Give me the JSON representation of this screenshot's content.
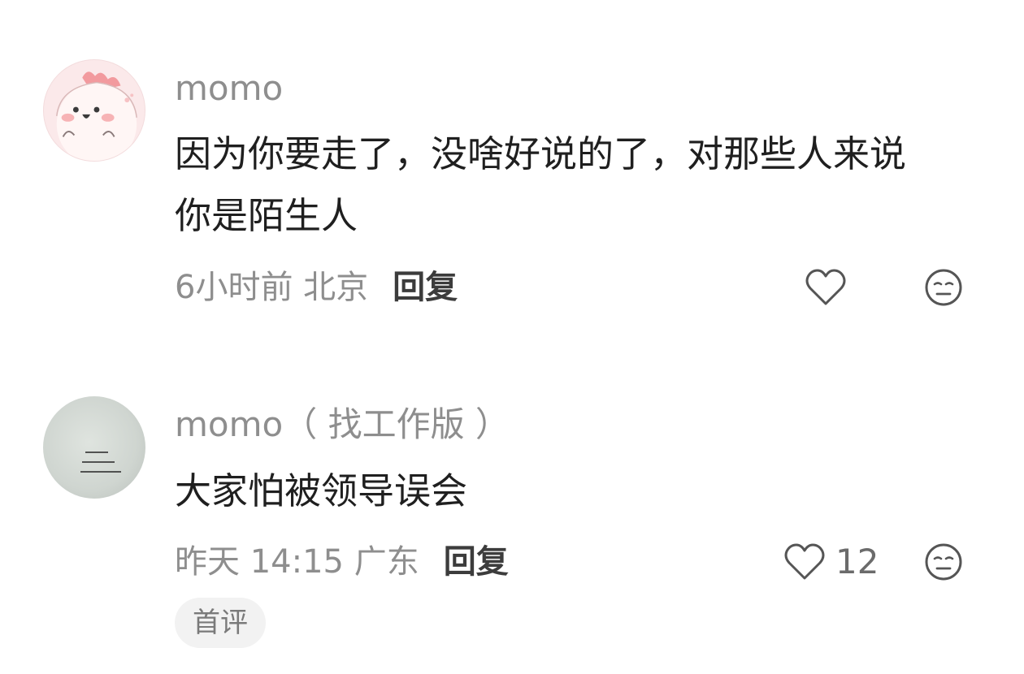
{
  "comments": [
    {
      "username": "momo",
      "avatar_icon": "cute-pink-character-avatar",
      "content_lines": [
        "因为你要走了，没啥好说的了，对那些人来说",
        "你是陌生人"
      ],
      "time_location": "6小时前 北京",
      "reply_label": "回复",
      "like_icon": "heart-outline-icon",
      "like_count": "",
      "emoji_icon": "neutral-face-icon"
    },
    {
      "username": "momo（ 找工作版 ）",
      "avatar_icon": "text-card-photo-avatar",
      "content_lines": [
        "大家怕被领导误会"
      ],
      "time_location": "昨天 14:15 广东",
      "reply_label": "回复",
      "like_icon": "heart-outline-icon",
      "like_count": "12",
      "emoji_icon": "neutral-face-icon",
      "badge": "首评"
    }
  ],
  "colors": {
    "username": "#8e8e8e",
    "content": "#1f1f1f",
    "meta": "#8e8e8e",
    "reply": "#3c3c3c",
    "icon": "#555555",
    "badge_bg": "#f2f2f2"
  }
}
